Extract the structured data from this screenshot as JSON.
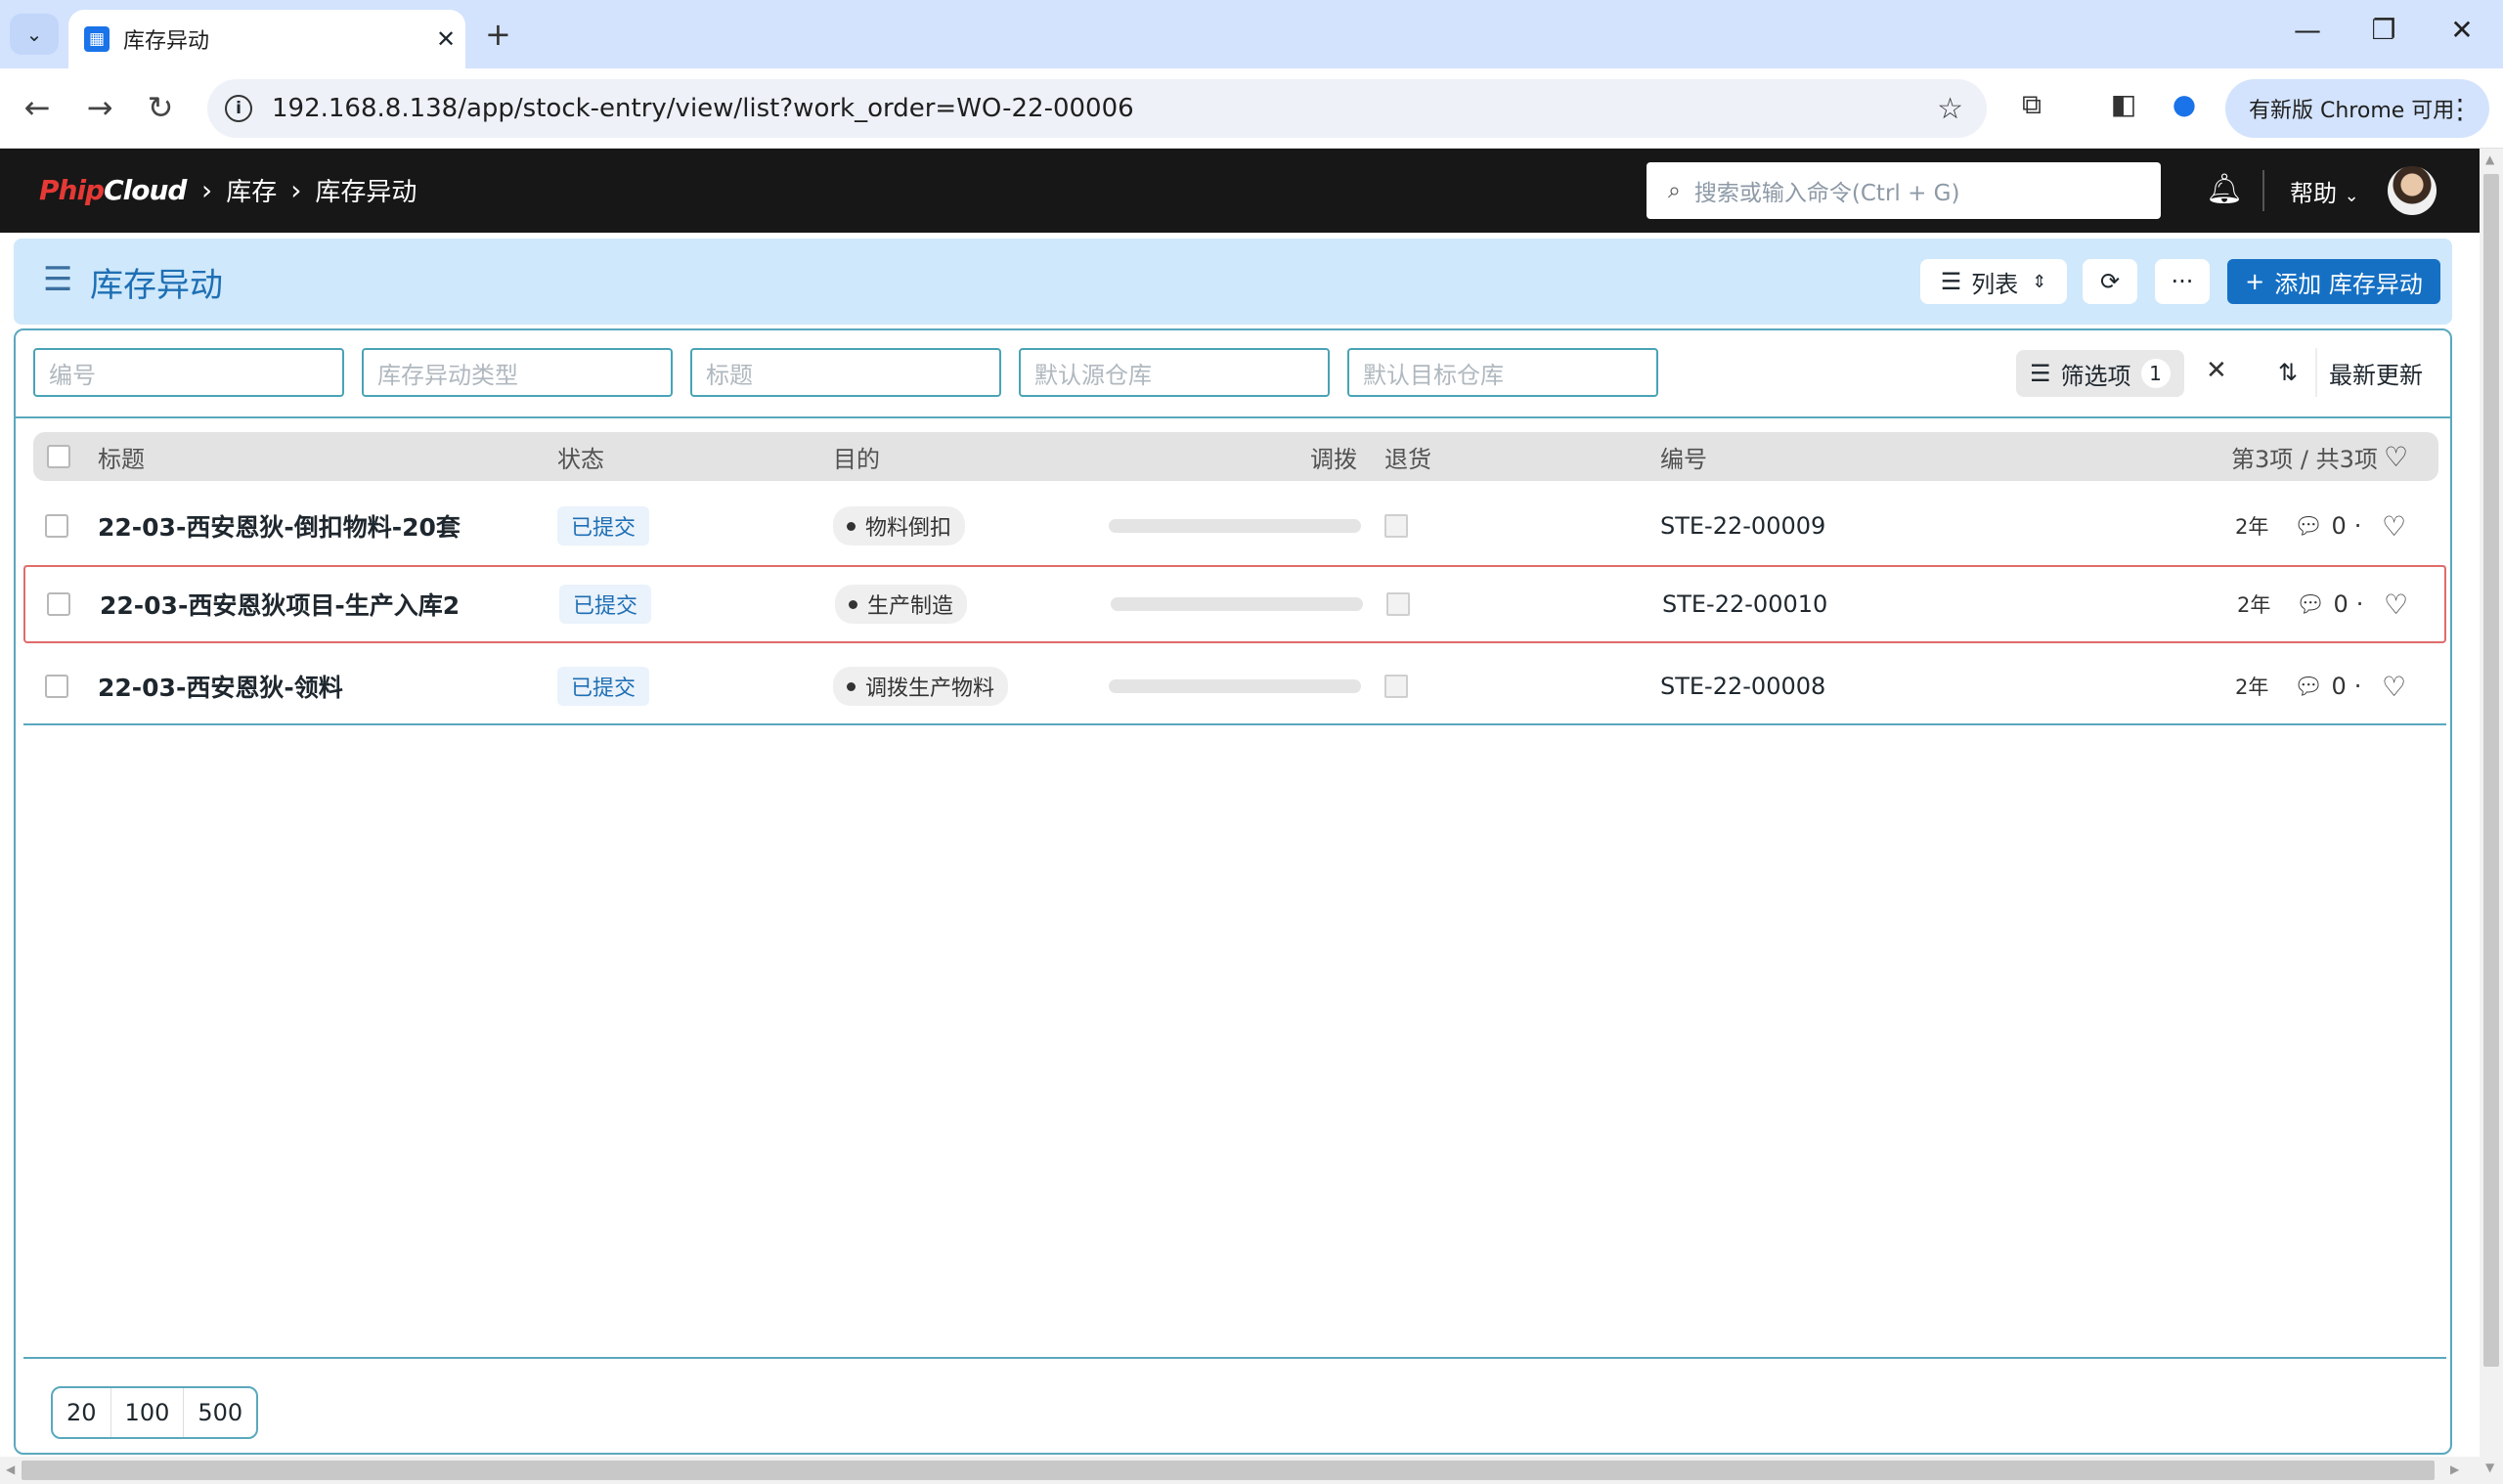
{
  "browser": {
    "tab_title": "库存异动",
    "tab_icon": "app-favicon",
    "url": "192.168.8.138/app/stock-entry/view/list?work_order=WO-22-00006",
    "update_label": "有新版 Chrome 可用"
  },
  "navbar": {
    "logo_part1": "Phip",
    "logo_part2": "Cloud",
    "breadcrumbs": [
      "库存",
      "库存异动"
    ],
    "search_placeholder": "搜索或输入命令(Ctrl + G)",
    "help_label": "帮助"
  },
  "page": {
    "title": "库存异动",
    "view_label": "列表",
    "more_label": "···",
    "add_label": "添加 库存异动"
  },
  "filters": {
    "fields": [
      "编号",
      "库存异动类型",
      "标题",
      "默认源仓库",
      "默认目标仓库"
    ],
    "filter_label": "筛选项",
    "filter_count": "1",
    "sort_label": "最新更新"
  },
  "table": {
    "headers": {
      "title": "标题",
      "status": "状态",
      "purpose": "目的",
      "transfer": "调拨",
      "return": "退货",
      "id": "编号",
      "count": "第3项 / 共3项"
    },
    "rows": [
      {
        "title": "22-03-西安恩狄-倒扣物料-20套",
        "status": "已提交",
        "purpose": "物料倒扣",
        "transfer_progress": 0,
        "id": "STE-22-00009",
        "age": "2年",
        "comments": "0"
      },
      {
        "title": "22-03-西安恩狄项目-生产入库2",
        "status": "已提交",
        "purpose": "生产制造",
        "transfer_progress": 0,
        "id": "STE-22-00010",
        "age": "2年",
        "comments": "0"
      },
      {
        "title": "22-03-西安恩狄-领料",
        "status": "已提交",
        "purpose": "调拨生产物料",
        "transfer_progress": 0,
        "id": "STE-22-00008",
        "age": "2年",
        "comments": "0"
      }
    ]
  },
  "pager": {
    "sizes": [
      "20",
      "100",
      "500"
    ]
  },
  "colors": {
    "accent": "#1570c4",
    "navbar": "#171717",
    "header_bg": "#cfe8fb"
  }
}
